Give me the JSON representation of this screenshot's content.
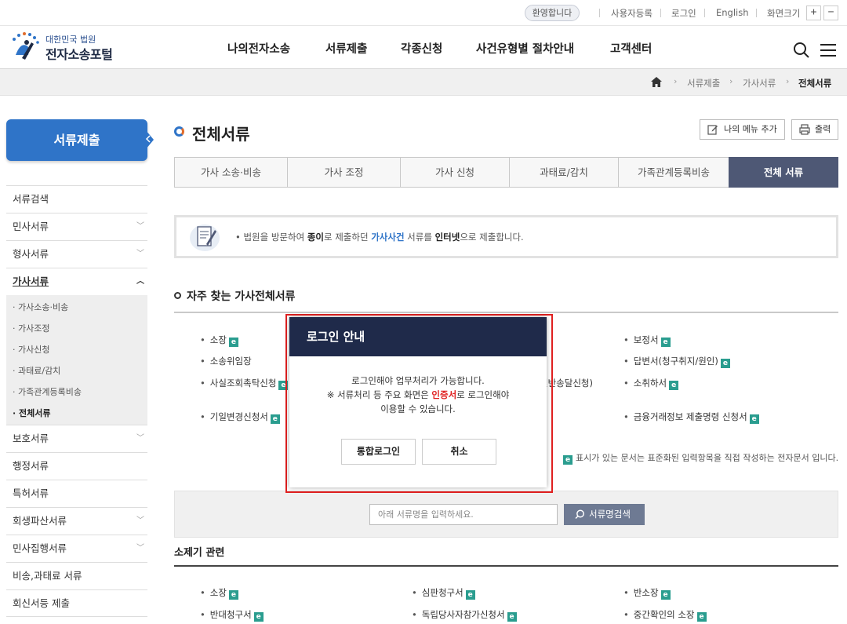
{
  "util": {
    "welcome": "환영합니다",
    "signup": "사용자등록",
    "login": "로그인",
    "english": "English",
    "font_size": "화면크기",
    "plus": "+",
    "minus": "−"
  },
  "logo": {
    "sub": "대한민국 법원",
    "main": "전자소송포털"
  },
  "gnb": [
    "나의전자소송",
    "서류제출",
    "각종신청",
    "사건유형별 절차안내",
    "고객센터"
  ],
  "breadcrumb": [
    "서류제출",
    "가사서류",
    "전체서류"
  ],
  "sidebar": {
    "title": "서류제출",
    "items": [
      "서류검색",
      "민사서류",
      "형사서류",
      "가사서류",
      "보호서류",
      "행정서류",
      "특허서류",
      "회생파산서류",
      "민사집행서류",
      "비송,과태료 서류",
      "회신서등 제출"
    ],
    "sub": [
      "가사소송·비송",
      "가사조정",
      "가사신청",
      "과태료/감치",
      "가족관계등록비송",
      "전체서류"
    ]
  },
  "page": {
    "title": "전체서류",
    "add_menu": "나의 메뉴 추가",
    "print": "출력"
  },
  "tabs": [
    "가사 소송·비송",
    "가사 조정",
    "가사 신청",
    "과태료/감치",
    "가족관계등록비송",
    "전체 서류"
  ],
  "notice": {
    "t1": "• 법원을 방문하여 ",
    "t2": "종이",
    "t3": "로 제출하던 ",
    "t4": "가사사건",
    "t5": " 서류를 ",
    "t6": "인터넷",
    "t7": "으로 제출합니다."
  },
  "section": {
    "title": "자주 찾는 가사전체서류",
    "col1": [
      "소장",
      "소송위임장",
      "사실조회촉탁신청",
      "기일변경신청서"
    ],
    "col2_partial": "실반송달신청)",
    "col3": [
      "보정서",
      "답변서(청구취지/원인)",
      "소취하서",
      "금융거래정보 제출명령 신청서"
    ],
    "ebadge": "e",
    "legend": "표시가 있는 문서는 표준화된 입력항목을 직접 작성하는 전자문서 입니다."
  },
  "search": {
    "placeholder": "아래 서류명을 입력하세요.",
    "button": "서류명검색"
  },
  "section2": {
    "title": "소제기 관련",
    "row1": [
      "소장",
      "심판청구서",
      "반소장"
    ],
    "row2": [
      "반대청구서",
      "독립당사자참가신청서",
      "중간확인의 소장"
    ]
  },
  "modal": {
    "title": "로그인 안내",
    "line1": "로그인해야 업무처리가 가능합니다.",
    "line2a": "※ 서류처리 등 주요 화면은 ",
    "line2b": "인증서",
    "line2c": "로 로그인해야",
    "line3": "이용할 수 있습니다.",
    "btn_login": "통합로그인",
    "btn_cancel": "취소"
  }
}
